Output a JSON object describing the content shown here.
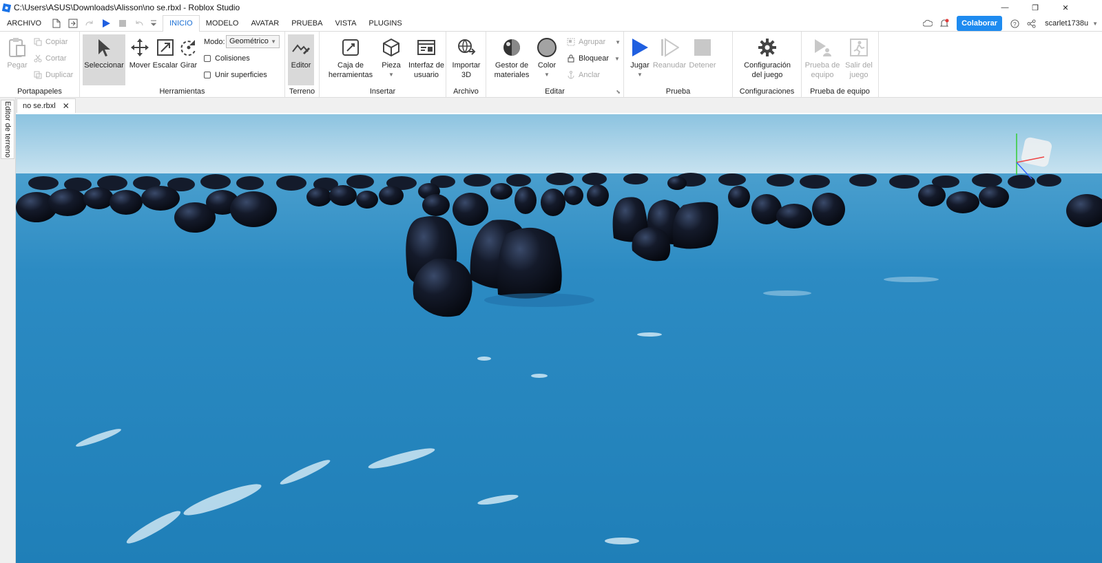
{
  "window": {
    "title": "C:\\Users\\ASUS\\Downloads\\Alisson\\no se.rbxl - Roblox Studio",
    "minimize_glyph": "—",
    "restore_glyph": "❐",
    "close_glyph": "✕"
  },
  "menubar": {
    "file_label": "ARCHIVO",
    "tabs": [
      {
        "label": "INICIO",
        "active": true
      },
      {
        "label": "MODELO",
        "active": false
      },
      {
        "label": "AVATAR",
        "active": false
      },
      {
        "label": "PRUEBA",
        "active": false
      },
      {
        "label": "VISTA",
        "active": false
      },
      {
        "label": "PLUGINS",
        "active": false
      }
    ],
    "collaborate_label": "Colaborar",
    "username": "scarlet1738u"
  },
  "ribbon": {
    "clipboard": {
      "paste": "Pegar",
      "copy": "Copiar",
      "cut": "Cortar",
      "duplicate": "Duplicar",
      "group": "Portapapeles"
    },
    "tools": {
      "select": "Seleccionar",
      "move": "Mover",
      "scale": "Escalar",
      "rotate": "Girar",
      "mode_label": "Modo:",
      "mode_value": "Geométrico",
      "collisions": "Colisiones",
      "join_surfaces": "Unir superficies",
      "group": "Herramientas"
    },
    "terrain": {
      "editor": "Editor",
      "group": "Terreno"
    },
    "insert": {
      "toolbox_1": "Caja de",
      "toolbox_2": "herramientas",
      "part": "Pieza",
      "ui_1": "Interfaz de",
      "ui_2": "usuario",
      "group": "Insertar"
    },
    "file": {
      "import_1": "Importar",
      "import_2": "3D",
      "group": "Archivo"
    },
    "edit": {
      "materials_1": "Gestor de",
      "materials_2": "materiales",
      "color": "Color",
      "group_btn": "Agrupar",
      "lock": "Bloquear",
      "anchor": "Anclar",
      "group": "Editar"
    },
    "test": {
      "play": "Jugar",
      "resume": "Reanudar",
      "stop": "Detener",
      "group": "Prueba"
    },
    "settings": {
      "game_1": "Configuración",
      "game_2": "del juego",
      "group": "Configuraciones"
    },
    "team_test": {
      "test_1": "Prueba de",
      "test_2": "equipo",
      "exit_1": "Salir del",
      "exit_2": "juego",
      "group": "Prueba de equipo"
    }
  },
  "document": {
    "tab_label": "no se.rbxl",
    "close_glyph": "✕"
  },
  "sidebar": {
    "terrain_editor_tab": "Editor de terreno"
  },
  "colors": {
    "accent": "#1e8bf0",
    "play_blue": "#1f5fe0",
    "ocean": "#2a8cc3"
  }
}
